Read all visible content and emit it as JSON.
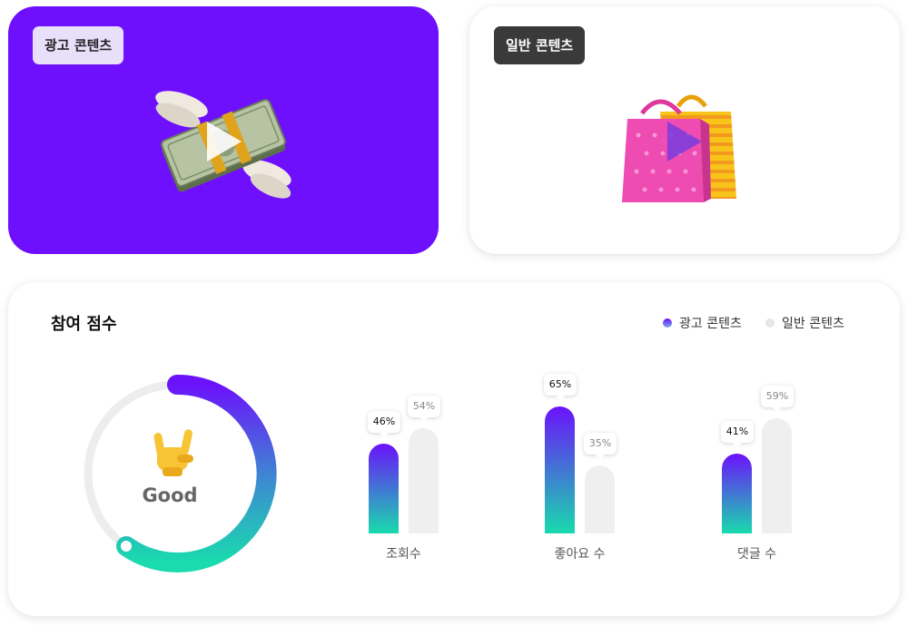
{
  "ad_card": {
    "badge": "광고 콘텐츠",
    "thumbnail_icon": "money-with-wings-icon",
    "background": "#6e0ffe"
  },
  "general_card": {
    "badge": "일반 콘텐츠",
    "thumbnail_icon": "shopping-bags-icon"
  },
  "engagement": {
    "title": "참여 점수",
    "legend": [
      {
        "label": "광고 콘텐츠",
        "color": "#6b6ff0"
      },
      {
        "label": "일반 콘텐츠",
        "color": "#e6e6e6"
      }
    ],
    "gauge": {
      "label": "Good",
      "icon": "rock-on-hand-icon"
    }
  },
  "chart_data": {
    "type": "bar",
    "categories": [
      "조회수",
      "좋아요 수",
      "댓글 수"
    ],
    "series": [
      {
        "name": "광고 콘텐츠",
        "values": [
          46,
          65,
          41
        ],
        "labels": [
          "46%",
          "65%",
          "41%"
        ]
      },
      {
        "name": "일반 콘텐츠",
        "values": [
          54,
          35,
          59
        ],
        "labels": [
          "54%",
          "35%",
          "59%"
        ]
      }
    ]
  }
}
